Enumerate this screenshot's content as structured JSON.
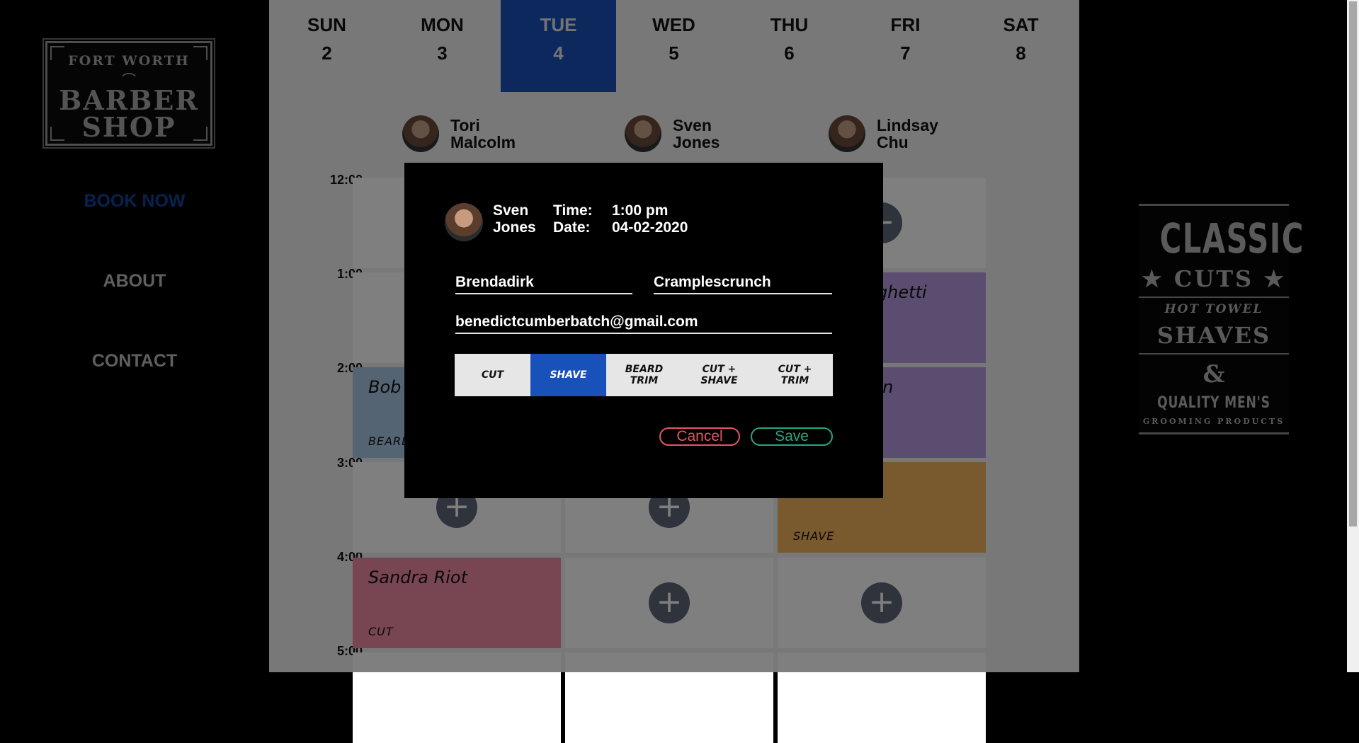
{
  "logo": {
    "top": "FORT WORTH",
    "line1": "BARBER",
    "line2": "SHOP"
  },
  "nav": {
    "book": "BOOK NOW",
    "about": "ABOUT",
    "contact": "CONTACT"
  },
  "days": [
    {
      "name": "SUN",
      "date": "2"
    },
    {
      "name": "MON",
      "date": "3"
    },
    {
      "name": "TUE",
      "date": "4",
      "selected": true
    },
    {
      "name": "WED",
      "date": "5"
    },
    {
      "name": "THU",
      "date": "6"
    },
    {
      "name": "FRI",
      "date": "7"
    },
    {
      "name": "SAT",
      "date": "8"
    }
  ],
  "barbers": [
    {
      "name": "Tori\nMalcolm"
    },
    {
      "name": "Sven\nJones"
    },
    {
      "name": "Lindsay\nChu"
    }
  ],
  "times": [
    "12:00",
    "1:00",
    "2:00",
    "3:00",
    "4:00",
    "5:00"
  ],
  "appointments": {
    "bob": {
      "name": "Bob",
      "service": "BEARD",
      "color": "#a9c9e6"
    },
    "spaghetti": {
      "name": "paghetti",
      "color": "#b79be0"
    },
    "man": {
      "name": "man",
      "color": "#b79be0"
    },
    "shave_slot": {
      "service": "SHAVE",
      "color": "#f2b35c"
    },
    "sandra": {
      "name": "Sandra Riot",
      "service": "CUT",
      "color": "#f08aa4"
    }
  },
  "modal": {
    "barber": "Sven\nJones",
    "time_label": "Time:",
    "time_value": "1:00 pm",
    "date_label": "Date:",
    "date_value": "04-02-2020",
    "first_name": "Brendadirk",
    "last_name": "Cramplescrunch",
    "email": "benedictcumberbatch@gmail.com",
    "services": [
      "CUT",
      "SHAVE",
      "BEARD\nTRIM",
      "CUT +\nSHAVE",
      "CUT +\nTRIM"
    ],
    "selected_service": "SHAVE",
    "cancel": "Cancel",
    "save": "Save"
  },
  "ad": {
    "line1": "CLASSIC",
    "line2": "★ CUTS ★",
    "line3": "HOT TOWEL",
    "line4": "SHAVES",
    "line5": "&",
    "line6": "QUALITY MEN'S",
    "line7": "GROOMING PRODUCTS"
  },
  "colors": {
    "accent": "#1951ba",
    "cancel": "#e35563",
    "save": "#27a583"
  }
}
